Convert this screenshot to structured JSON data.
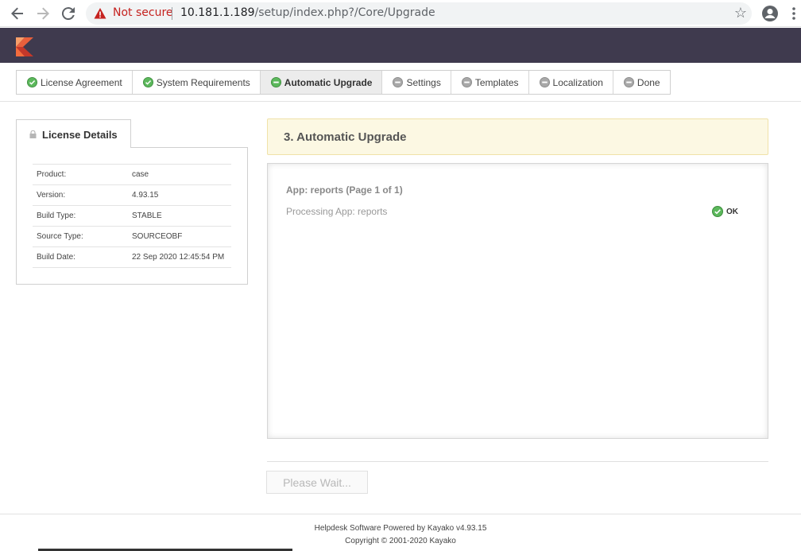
{
  "browser": {
    "security_label": "Not secure",
    "url_host": "10.181.1.189",
    "url_path": "/setup/index.php?/Core/Upgrade",
    "icons": [
      "back-arrow-icon",
      "forward-arrow-icon",
      "reload-icon",
      "warning-icon",
      "star-icon",
      "account-icon",
      "menu-kebab-icon"
    ]
  },
  "steps": [
    {
      "label": "License Agreement",
      "state": "done"
    },
    {
      "label": "System Requirements",
      "state": "done"
    },
    {
      "label": "Automatic Upgrade",
      "state": "active"
    },
    {
      "label": "Settings",
      "state": "pending"
    },
    {
      "label": "Templates",
      "state": "pending"
    },
    {
      "label": "Localization",
      "state": "pending"
    },
    {
      "label": "Done",
      "state": "pending"
    }
  ],
  "license": {
    "title": "License Details",
    "rows": [
      {
        "key": "Product:",
        "value": "case"
      },
      {
        "key": "Version:",
        "value": "4.93.15"
      },
      {
        "key": "Build Type:",
        "value": "STABLE"
      },
      {
        "key": "Source Type:",
        "value": "SOURCEOBF"
      },
      {
        "key": "Build Date:",
        "value": "22 Sep 2020 12:45:54 PM"
      }
    ]
  },
  "main": {
    "title": "3.  Automatic Upgrade",
    "app_title": "App: reports (Page 1 of 1)",
    "processing": "Processing App: reports",
    "status": "OK"
  },
  "wait_button": "Please Wait...",
  "footer": {
    "line1": "Helpdesk Software Powered by Kayako v4.93.15",
    "line2": "Copyright © 2001-2020 Kayako"
  },
  "colors": {
    "header_bg": "#3f3a4e",
    "done_green": "#5cb85c",
    "pending_gray": "#9e9e9e",
    "title_bg": "#fcf8e3"
  }
}
